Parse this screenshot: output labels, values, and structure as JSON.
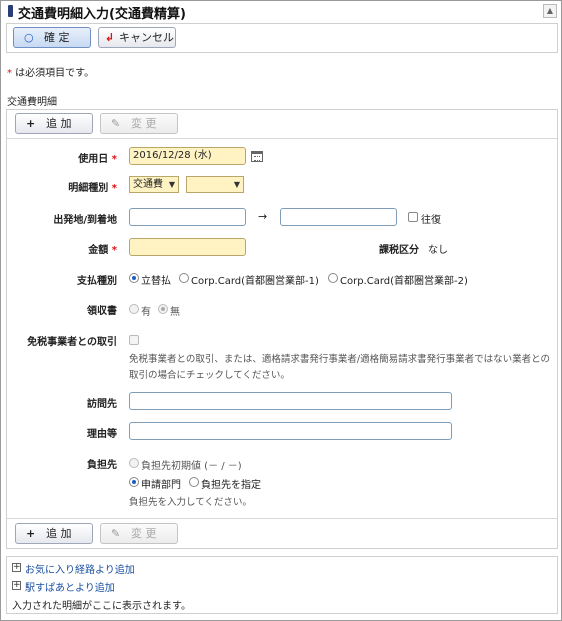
{
  "header": {
    "title": "交通費明細入力(交通費精算)"
  },
  "toolbar": {
    "confirm_label": "確 定",
    "cancel_label": "キャンセル"
  },
  "note": {
    "asterisk": "*",
    "text": " は必須項目です。"
  },
  "section": {
    "label": "交通費明細"
  },
  "detail_toolbar": {
    "add_label": "追 加",
    "change_label": "変 更"
  },
  "form": {
    "usage_date": {
      "label": "使用日",
      "value": "2016/12/28 (水)"
    },
    "detail_type": {
      "label": "明細種別",
      "value": "交通費",
      "value2": ""
    },
    "route": {
      "label": "出発地/到着地",
      "arrow": "→",
      "from": "",
      "to": "",
      "roundtrip_label": "往復"
    },
    "amount": {
      "label": "金額",
      "value": ""
    },
    "tax_category": {
      "label": "課税区分",
      "value": "なし"
    },
    "payment_type": {
      "label": "支払種別",
      "options": [
        "立替払",
        "Corp.Card(首都圏営業部-1)",
        "Corp.Card(首都圏営業部-2)"
      ],
      "selected": "立替払"
    },
    "receipt": {
      "label": "領収書",
      "options": [
        "有",
        "無"
      ],
      "selected": "無"
    },
    "tax_exempt": {
      "label": "免税事業者との取引",
      "help_line1": "免税事業者との取引、または、適格請求書発行事業者/適格簡易請求書発行事業者ではない業者との",
      "help_line2": "取引の場合にチェックしてください。"
    },
    "destination": {
      "label": "訪問先",
      "value": ""
    },
    "reason": {
      "label": "理由等",
      "value": ""
    },
    "burden": {
      "label": "負担先",
      "option_initial": "負担先初期値 (－ / －)",
      "option_dept": "申請部門",
      "option_specify": "負担先を指定",
      "help": "負担先を入力してください。"
    },
    "required_mark": "*"
  },
  "bottom": {
    "favorite_route_link": "お気に入り経路より追加",
    "ekispert_link": "駅すぱあとより追加",
    "empty_message": "入力された明細がここに表示されます。"
  },
  "colors": {
    "required_bg": "#fff3c4",
    "link": "#1a4fa0",
    "title_mark": "#2b3e7a",
    "required_mark": "#dd1111"
  },
  "icons": {
    "confirm": "circle-icon",
    "cancel": "return-arrow-icon",
    "add": "plus-icon",
    "change": "pencil-icon",
    "calendar": "calendar-icon",
    "expand": "plus-box-icon"
  }
}
